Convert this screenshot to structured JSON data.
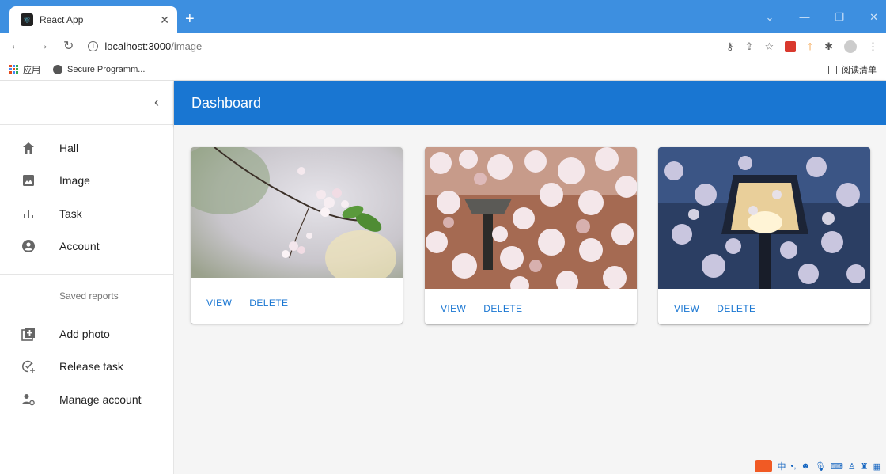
{
  "browser": {
    "tab_title": "React App",
    "url_host": "localhost:3000",
    "url_path": "/image",
    "bookmarks": [
      {
        "label": "应用"
      },
      {
        "label": "Secure Programm..."
      }
    ],
    "reading_list": "阅读清单"
  },
  "header": {
    "title": "Dashboard"
  },
  "sidebar": {
    "collapse_icon": "chevron-left-icon",
    "items": [
      {
        "label": "Hall",
        "icon": "home-icon"
      },
      {
        "label": "Image",
        "icon": "image-icon"
      },
      {
        "label": "Task",
        "icon": "bar-chart-icon"
      },
      {
        "label": "Account",
        "icon": "account-circle-icon"
      }
    ],
    "saved_header": "Saved reports",
    "saved_items": [
      {
        "label": "Add photo",
        "icon": "add-photo-icon"
      },
      {
        "label": "Release task",
        "icon": "release-task-icon"
      },
      {
        "label": "Manage account",
        "icon": "manage-account-icon"
      }
    ]
  },
  "cards": [
    {
      "image": "cherry-blossom-branch",
      "view_label": "VIEW",
      "delete_label": "DELETE"
    },
    {
      "image": "cherry-blossom-lamp",
      "view_label": "VIEW",
      "delete_label": "DELETE"
    },
    {
      "image": "cherry-blossom-lamp-night",
      "view_label": "VIEW",
      "delete_label": "DELETE"
    }
  ],
  "ime_tray": {
    "ch": "中"
  },
  "colors": {
    "primary": "#1976d2",
    "tab_bar": "#3d8fe0"
  }
}
